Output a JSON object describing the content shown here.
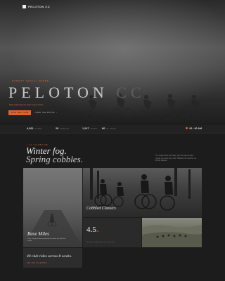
{
  "header": {
    "logo_text": "PELOTON CC"
  },
  "hero": {
    "kicker": "· SUNDAY SOCIAL RIDES ·",
    "brand_main": "PELOTON",
    "brand_cc": "CC",
    "tagline": "Ride with purpose. Earn every climb.",
    "primary_button": "JOIN THE CLUB",
    "secondary_link": "VIEW THE ROUTE →"
  },
  "stats": {
    "items": [
      {
        "value": "4,281",
        "label": "km ridden"
      },
      {
        "value": "28",
        "label": "weekly rides"
      },
      {
        "value": "1,247",
        "label": "members"
      },
      {
        "value": "86",
        "delta": "%",
        "label": "retention"
      }
    ],
    "live": "06 : 00 AM"
  },
  "section": {
    "kicker": "— 01 / CLUB LIFE",
    "headline_1": "Winter fog.",
    "headline_2": "Spring cobbles.",
    "blurb": "The season does not matter, only the miles and the people you share them with. Whatever the weather, we roll out together."
  },
  "cards": {
    "base_miles": {
      "title": "Base Miles",
      "sub": "Long, steady kilometres through the winter fog. Build the engine."
    },
    "cobbled": {
      "title": "Cobbled Classics"
    },
    "metric": {
      "value": "4.5",
      "unit": "hrs",
      "label": "Average weekly ride time across the club"
    },
    "clubs": {
      "title": "40 club rides across 8 weeks.",
      "link": "SEE THE CALENDAR →"
    }
  },
  "colors": {
    "accent": "#e0602f",
    "bg": "#1c1c1c"
  }
}
